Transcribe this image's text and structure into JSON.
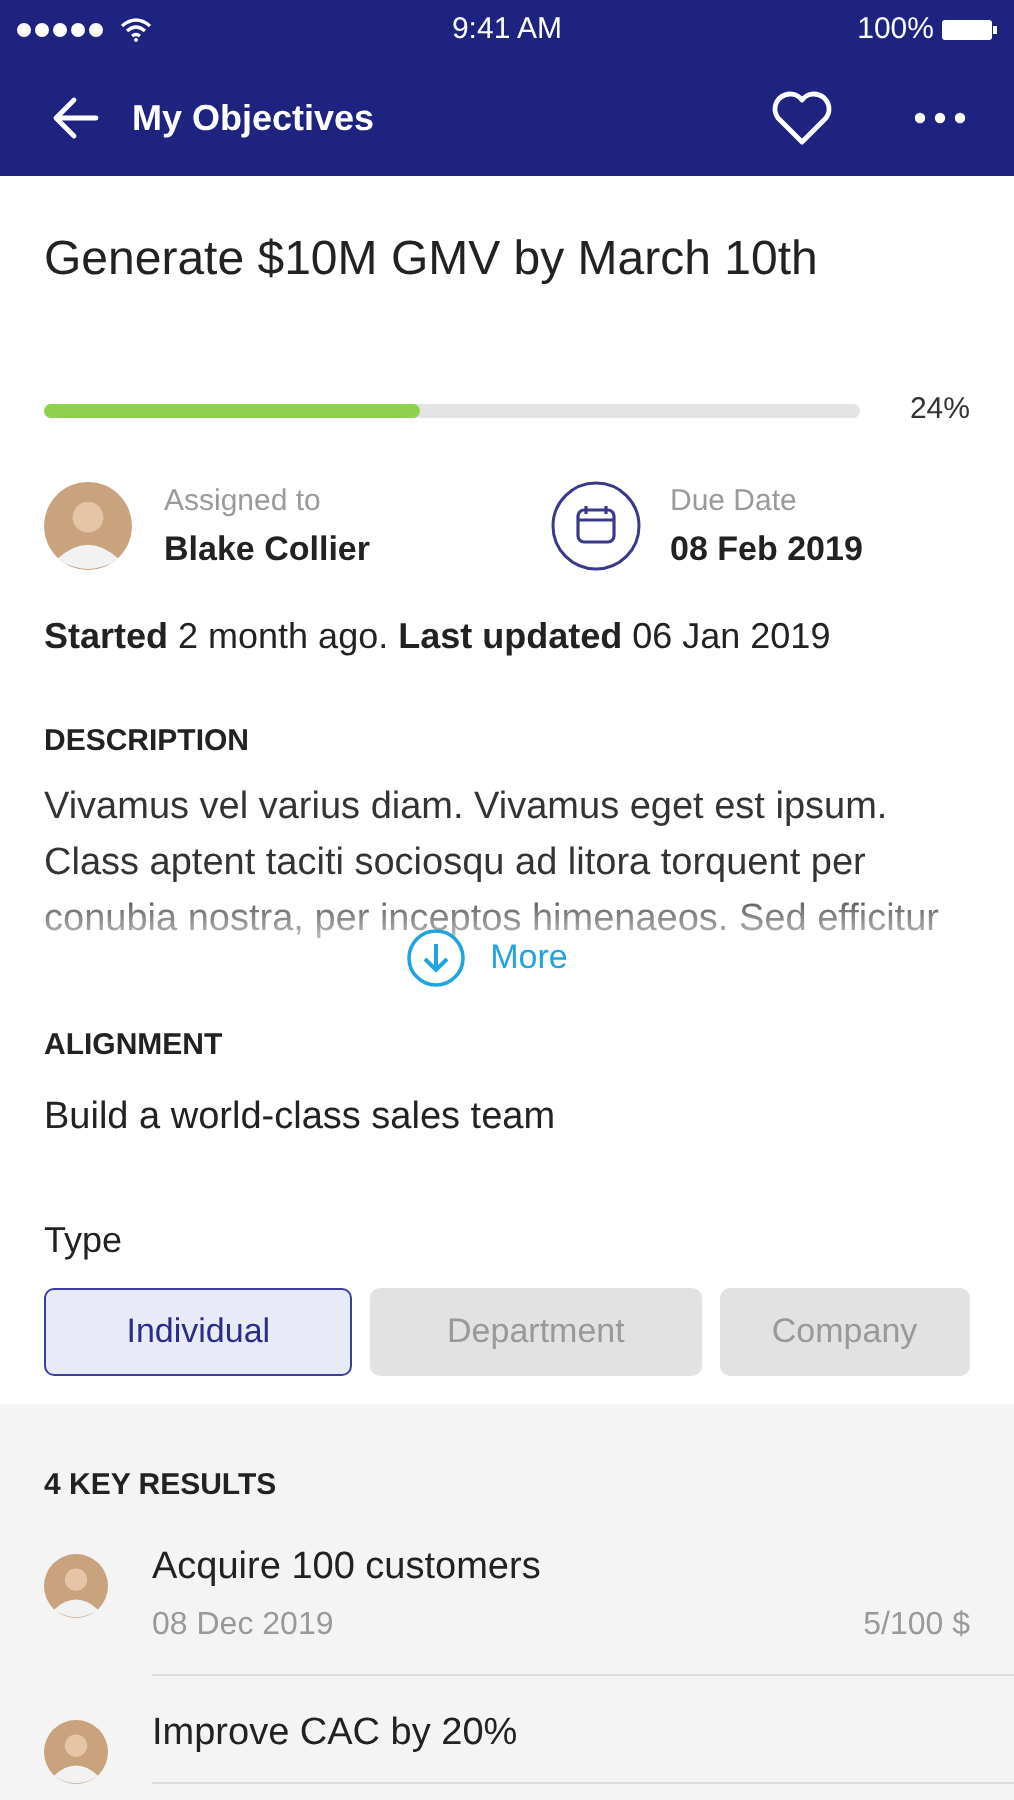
{
  "status_bar": {
    "time": "9:41 AM",
    "battery": "100%"
  },
  "nav": {
    "title": "My Objectives"
  },
  "objective": {
    "title": "Generate $10M GMV by March 10th",
    "progress": {
      "level": 0.46,
      "reading": "24%"
    }
  },
  "assigned": {
    "label": "Assigned to",
    "name": "Blake Collier"
  },
  "due": {
    "label": "Due Date",
    "date": "08 Feb 2019"
  },
  "meta": "**Started** 2 month ago. **Last updated** 06 Jan 2019",
  "description": {
    "heading": "DESCRIPTION",
    "text": "Vivamus vel varius diam. Vivamus eget est ipsum. Class aptent taciti sociosqu ad litora torquent per conubia nostra, per inceptos himenaeos. Sed efficitur",
    "more": "More"
  },
  "alignment": {
    "heading": "ALIGNMENT",
    "text": "Build a world-class sales team"
  },
  "type": {
    "label": "Type",
    "options": [
      {
        "label": "Individual",
        "selected": true
      },
      {
        "label": "Department",
        "selected": false
      },
      {
        "label": "Company",
        "selected": false
      }
    ]
  },
  "key_results": {
    "heading": "4 KEY RESULTS",
    "items": [
      {
        "title": "Acquire 100 customers",
        "date": "08 Dec 2019",
        "value": "5/100 $"
      },
      {
        "title": "Improve CAC by 20%"
      }
    ]
  }
}
